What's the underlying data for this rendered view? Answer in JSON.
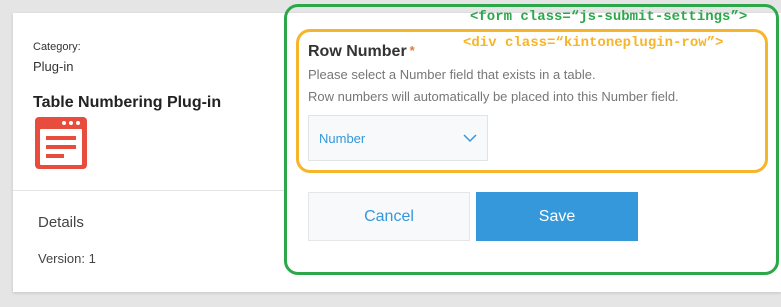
{
  "plugin": {
    "category_label": "Category:",
    "category_value": "Plug-in",
    "title": "Table Numbering Plug-in",
    "icon": "document-list-icon",
    "details_label": "Details",
    "version": "Version: 1"
  },
  "form": {
    "annotation": "<form class=“js-submit-settings”>",
    "row": {
      "annotation": "<div class=“kintoneplugin-row”>",
      "title": "Row Number",
      "required_mark": "*",
      "description_line1": "Please select a Number field that exists in a table.",
      "description_line2": "Row numbers will automatically be placed into this Number field.",
      "select_value": "Number"
    },
    "cancel_label": "Cancel",
    "save_label": "Save"
  },
  "colors": {
    "accent_blue": "#3498db",
    "form_outline_green": "#2ca84a",
    "row_outline_orange": "#f6b52a",
    "icon_red": "#e74c3c"
  }
}
